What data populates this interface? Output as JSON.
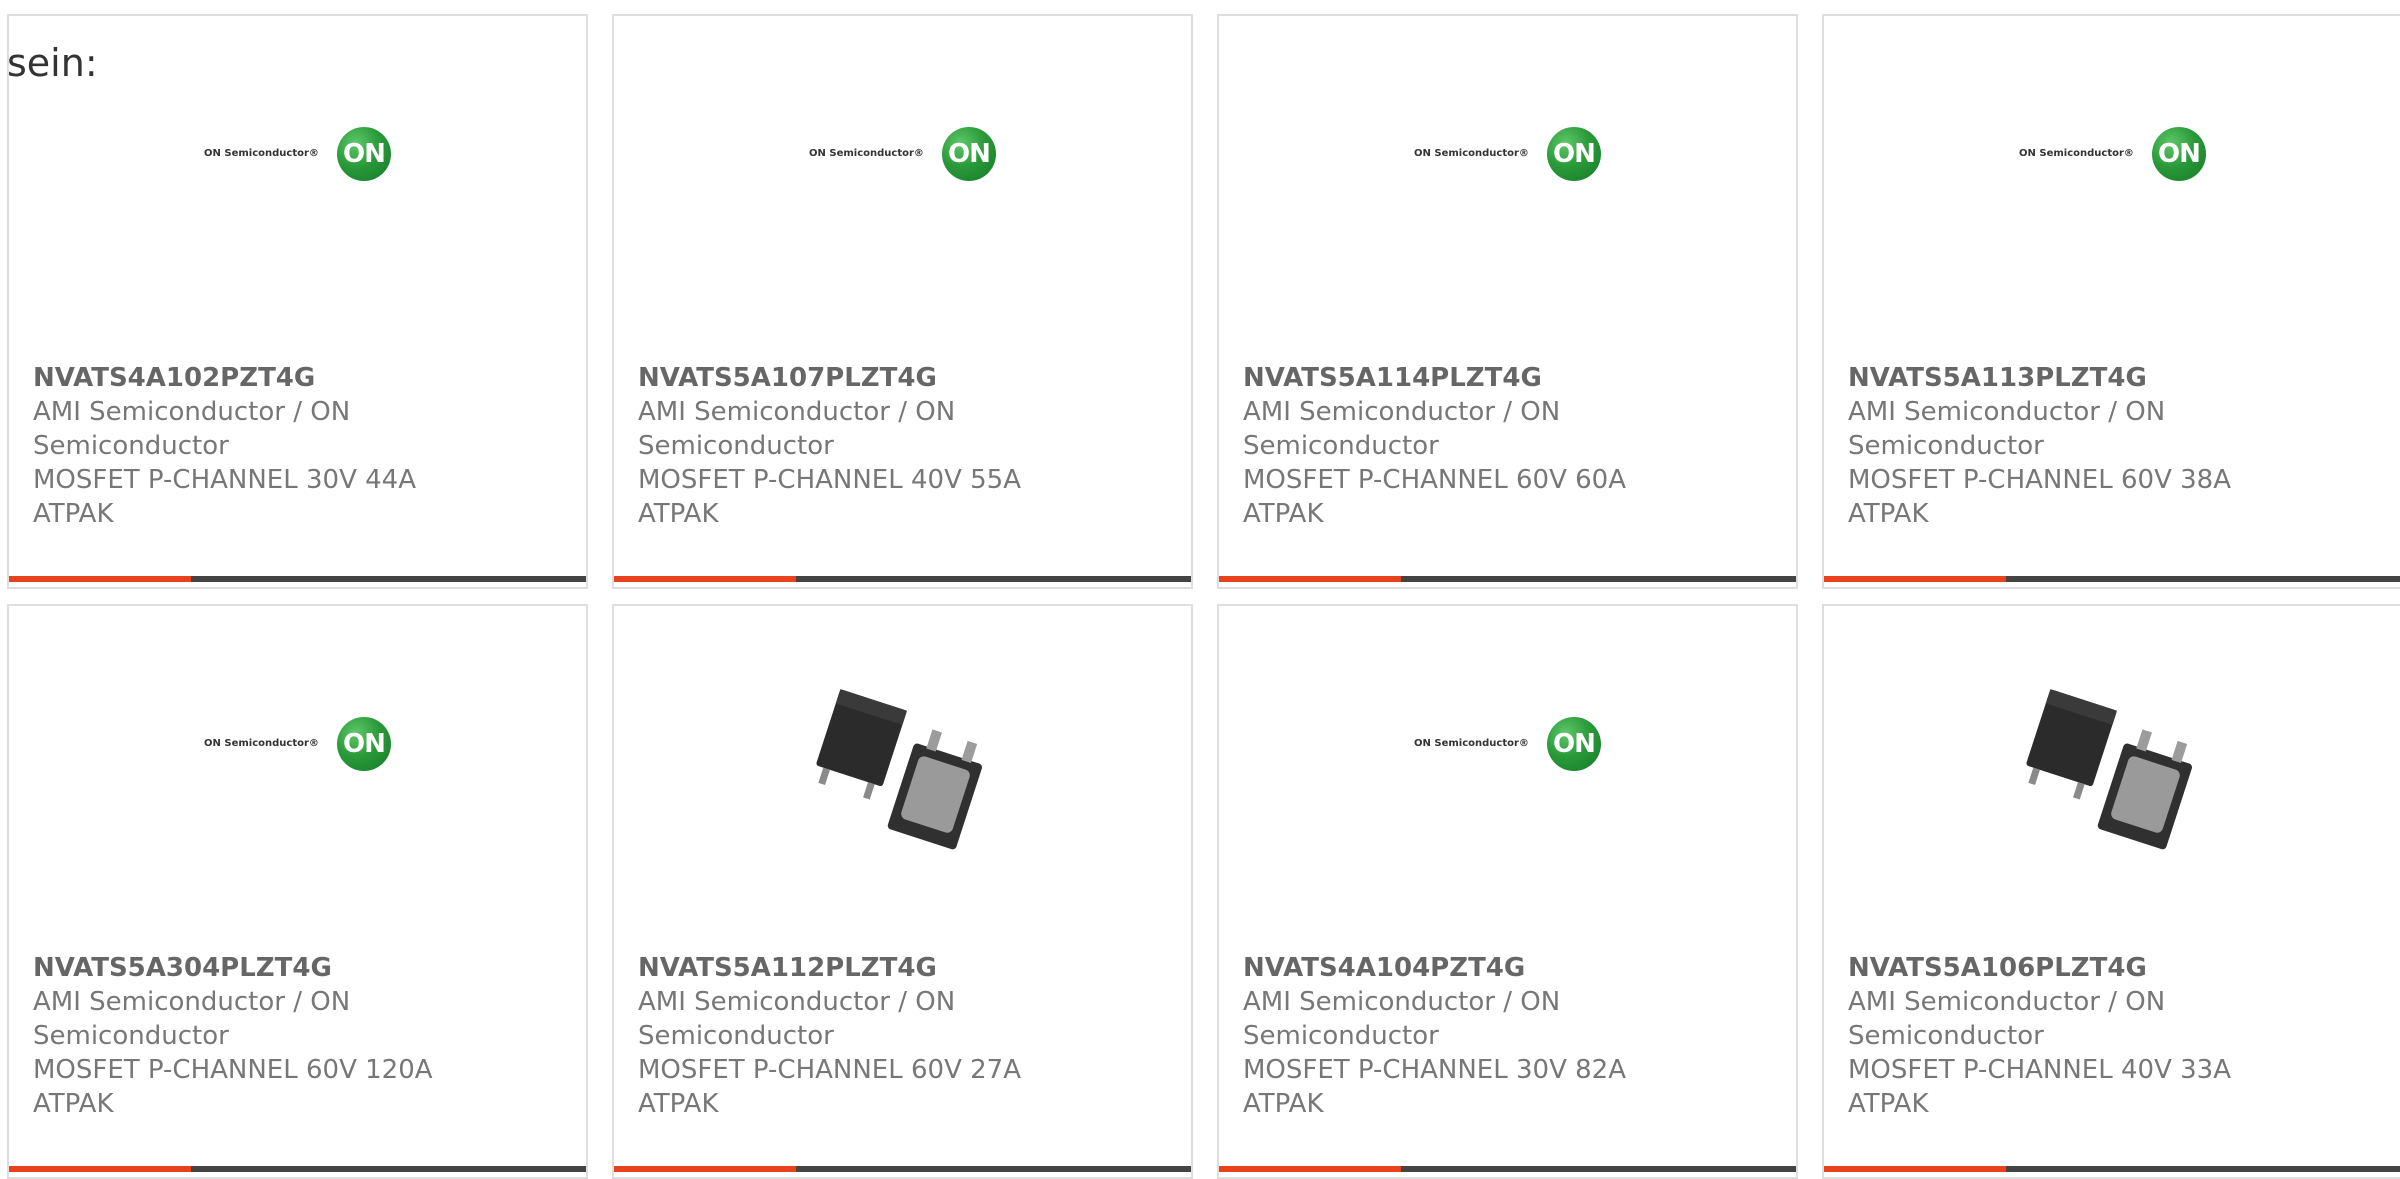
{
  "lead_text": "sein:",
  "colors": {
    "accent": "#e8411d",
    "bar": "#444444",
    "brand_green": "#2b9a3a"
  },
  "products": [
    {
      "part": "NVATS4A102PZT4G",
      "maker": "AMI Semiconductor / ON Semiconductor",
      "desc": "MOSFET P-CHANNEL 30V 44A ATPAK",
      "image": "on-semiconductor-logo",
      "logo_brand": "ON Semiconductor®",
      "logo_mark": "ON"
    },
    {
      "part": "NVATS5A107PLZT4G",
      "maker": "AMI Semiconductor / ON Semiconductor",
      "desc": "MOSFET P-CHANNEL 40V 55A ATPAK",
      "image": "on-semiconductor-logo",
      "logo_brand": "ON Semiconductor®",
      "logo_mark": "ON"
    },
    {
      "part": "NVATS5A114PLZT4G",
      "maker": "AMI Semiconductor / ON Semiconductor",
      "desc": "MOSFET P-CHANNEL 60V 60A ATPAK",
      "image": "on-semiconductor-logo",
      "logo_brand": "ON Semiconductor®",
      "logo_mark": "ON"
    },
    {
      "part": "NVATS5A113PLZT4G",
      "maker": "AMI Semiconductor / ON Semiconductor",
      "desc": "MOSFET P-CHANNEL 60V 38A ATPAK",
      "image": "on-semiconductor-logo",
      "logo_brand": "ON Semiconductor®",
      "logo_mark": "ON"
    },
    {
      "part": "NVATS5A304PLZT4G",
      "maker": "AMI Semiconductor / ON Semiconductor",
      "desc": "MOSFET P-CHANNEL 60V 120A ATPAK",
      "image": "on-semiconductor-logo",
      "logo_brand": "ON Semiconductor®",
      "logo_mark": "ON"
    },
    {
      "part": "NVATS5A112PLZT4G",
      "maker": "AMI Semiconductor / ON Semiconductor",
      "desc": "MOSFET P-CHANNEL 60V 27A ATPAK",
      "image": "atpak-package-photo"
    },
    {
      "part": "NVATS4A104PZT4G",
      "maker": "AMI Semiconductor / ON Semiconductor",
      "desc": "MOSFET P-CHANNEL 30V 82A ATPAK",
      "image": "on-semiconductor-logo",
      "logo_brand": "ON Semiconductor®",
      "logo_mark": "ON"
    },
    {
      "part": "NVATS5A106PLZT4G",
      "maker": "AMI Semiconductor / ON Semiconductor",
      "desc": "MOSFET P-CHANNEL 40V 33A ATPAK",
      "image": "atpak-package-photo"
    }
  ]
}
